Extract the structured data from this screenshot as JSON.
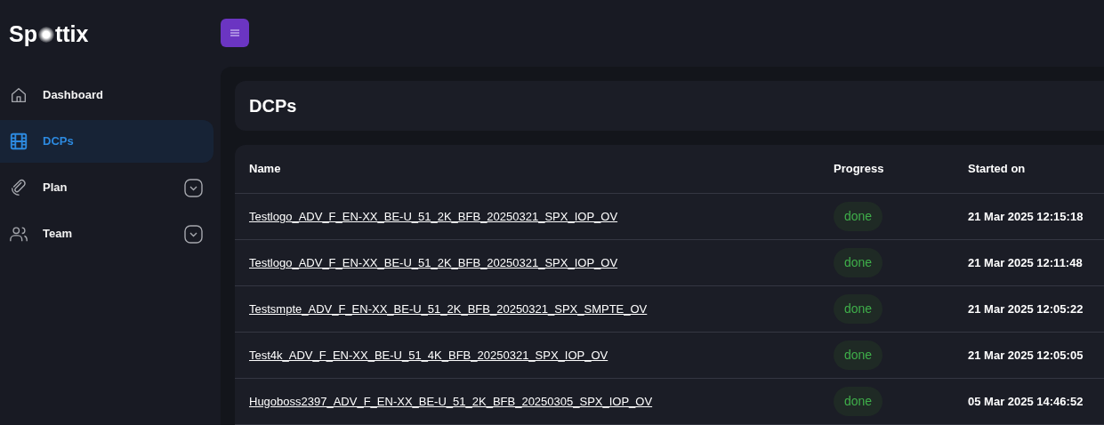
{
  "logo": {
    "before": "Sp",
    "after": "ttix"
  },
  "nav": [
    {
      "label": "Dashboard",
      "selected": false,
      "expandable": false
    },
    {
      "label": "DCPs",
      "selected": true,
      "expandable": false
    },
    {
      "label": "Plan",
      "selected": false,
      "expandable": true
    },
    {
      "label": "Team",
      "selected": false,
      "expandable": true
    }
  ],
  "page_title": "DCPs",
  "table": {
    "columns": [
      "Name",
      "Progress",
      "Started on"
    ],
    "rows": [
      {
        "name": "Testlogo_ADV_F_EN-XX_BE-U_51_2K_BFB_20250321_SPX_IOP_OV",
        "progress": "done",
        "started_on": "21 Mar 2025 12:15:18"
      },
      {
        "name": "Testlogo_ADV_F_EN-XX_BE-U_51_2K_BFB_20250321_SPX_IOP_OV",
        "progress": "done",
        "started_on": "21 Mar 2025 12:11:48"
      },
      {
        "name": "Testsmpte_ADV_F_EN-XX_BE-U_51_2K_BFB_20250321_SPX_SMPTE_OV",
        "progress": "done",
        "started_on": "21 Mar 2025 12:05:22"
      },
      {
        "name": "Test4k_ADV_F_EN-XX_BE-U_51_4K_BFB_20250321_SPX_IOP_OV",
        "progress": "done",
        "started_on": "21 Mar 2025 12:05:05"
      },
      {
        "name": "Hugoboss2397_ADV_F_EN-XX_BE-U_51_2K_BFB_20250305_SPX_IOP_OV",
        "progress": "done",
        "started_on": "05 Mar 2025 14:46:52"
      }
    ]
  }
}
